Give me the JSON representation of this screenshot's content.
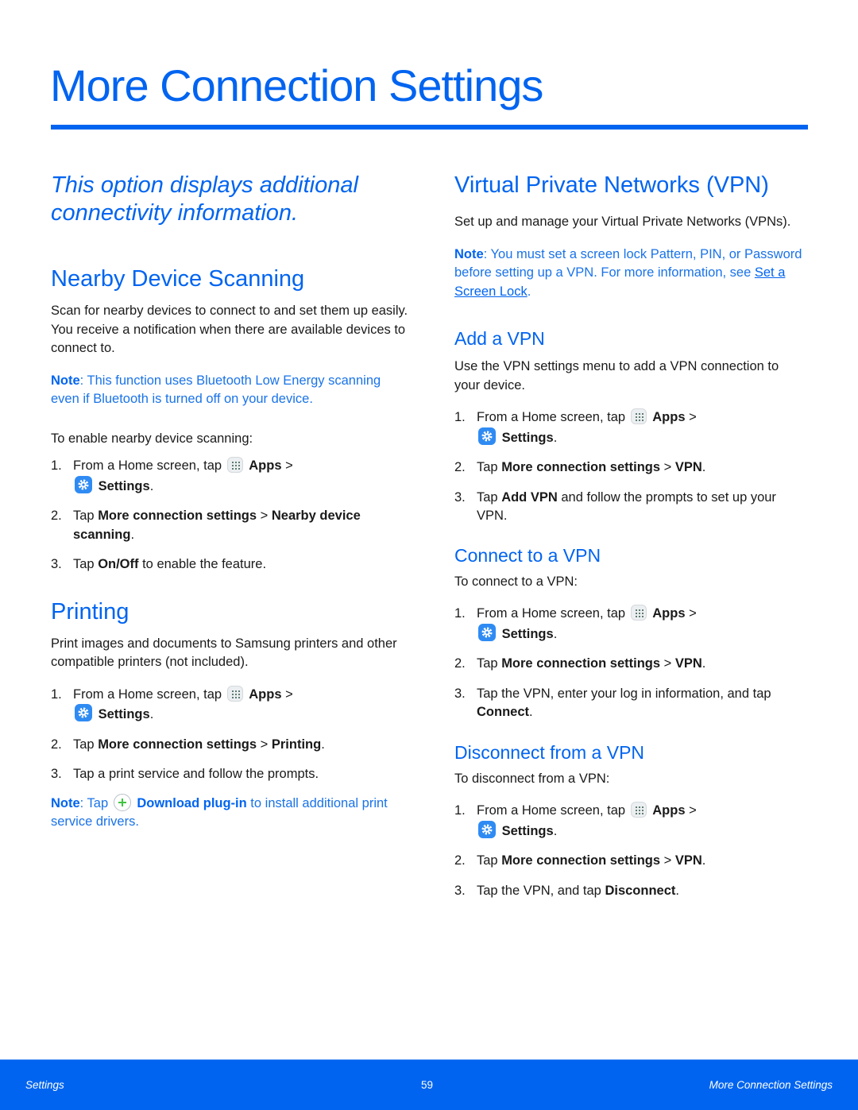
{
  "page": {
    "title": "More Connection Settings",
    "intro": "This option displays additional connectivity information."
  },
  "icons": {
    "apps": "apps-grid-icon",
    "settings": "settings-gear-icon",
    "download": "plus-circle-icon"
  },
  "colors": {
    "accent": "#0064f0",
    "note": "#1a73e8",
    "text": "#1a1a1a"
  },
  "nearby": {
    "heading": "Nearby Device Scanning",
    "body": "Scan for nearby devices to connect to and set them up easily. You receive a notification when there are available devices to connect to.",
    "note_label": "Note",
    "note_text": ": This function uses Bluetooth Low Energy scanning even if Bluetooth is turned off on your device.",
    "lead": "To enable nearby device scanning:",
    "steps": [
      {
        "num": "1.",
        "pre": "From a Home screen, tap ",
        "apps": "Apps",
        "sep": " > ",
        "settings": "Settings",
        "end": "."
      },
      {
        "num": "2.",
        "pre": "Tap ",
        "bold1": "More connection settings",
        "sep": " > ",
        "bold2": "Nearby device scanning",
        "end": "."
      },
      {
        "num": "3.",
        "pre": "Tap ",
        "bold1": "On/Off",
        "post": " to enable the feature."
      }
    ]
  },
  "printing": {
    "heading": "Printing",
    "body": "Print images and documents to Samsung printers and other compatible printers (not included).",
    "steps": [
      {
        "num": "1.",
        "pre": "From a Home screen, tap ",
        "apps": "Apps",
        "sep": " > ",
        "settings": "Settings",
        "end": "."
      },
      {
        "num": "2.",
        "pre": "Tap ",
        "bold1": "More connection settings",
        "sep": " > ",
        "bold2": "Printing",
        "end": "."
      },
      {
        "num": "3.",
        "text": "Tap a print service and follow the prompts."
      }
    ],
    "note_label": "Note",
    "note_pre": ": Tap ",
    "note_bold": "Download plug-in",
    "note_post": " to install additional print service drivers."
  },
  "vpn": {
    "heading": "Virtual Private Networks (VPN)",
    "body": "Set up and manage your Virtual Private Networks (VPNs).",
    "note_label": "Note",
    "note_text": ": You must set a screen lock Pattern, PIN, or Password before setting up a VPN. For more information, see ",
    "note_link": "Set a Screen Lock",
    "note_end": ".",
    "add": {
      "heading": "Add a VPN",
      "body": "Use the VPN settings menu to add a VPN connection to your device.",
      "steps": [
        {
          "num": "1.",
          "pre": "From a Home screen, tap ",
          "apps": "Apps",
          "sep": " > ",
          "settings": "Settings",
          "end": "."
        },
        {
          "num": "2.",
          "pre": "Tap ",
          "bold1": "More connection settings",
          "sep": " > ",
          "bold2": "VPN",
          "end": "."
        },
        {
          "num": "3.",
          "pre": "Tap ",
          "bold1": "Add VPN",
          "post": " and follow the prompts to set up your VPN."
        }
      ]
    },
    "connect": {
      "heading": "Connect to a VPN",
      "lead": "To connect to a VPN:",
      "steps": [
        {
          "num": "1.",
          "pre": "From a Home screen, tap ",
          "apps": "Apps",
          "sep": " > ",
          "settings": "Settings",
          "end": "."
        },
        {
          "num": "2.",
          "pre": "Tap ",
          "bold1": "More connection settings",
          "sep": " > ",
          "bold2": "VPN",
          "end": "."
        },
        {
          "num": "3.",
          "pre": "Tap the VPN, enter your log in information, and tap ",
          "bold1": "Connect",
          "end": "."
        }
      ]
    },
    "disconnect": {
      "heading": "Disconnect from a VPN",
      "lead": "To disconnect from a VPN:",
      "steps": [
        {
          "num": "1.",
          "pre": "From a Home screen, tap ",
          "apps": "Apps",
          "sep": " > ",
          "settings": "Settings",
          "end": "."
        },
        {
          "num": "2.",
          "pre": "Tap ",
          "bold1": "More connection settings",
          "sep": " > ",
          "bold2": "VPN",
          "end": "."
        },
        {
          "num": "3.",
          "pre": "Tap the VPN, and tap ",
          "bold1": "Disconnect",
          "end": "."
        }
      ]
    }
  },
  "footer": {
    "left": "Settings",
    "page_number": "59",
    "right": "More Connection Settings"
  }
}
